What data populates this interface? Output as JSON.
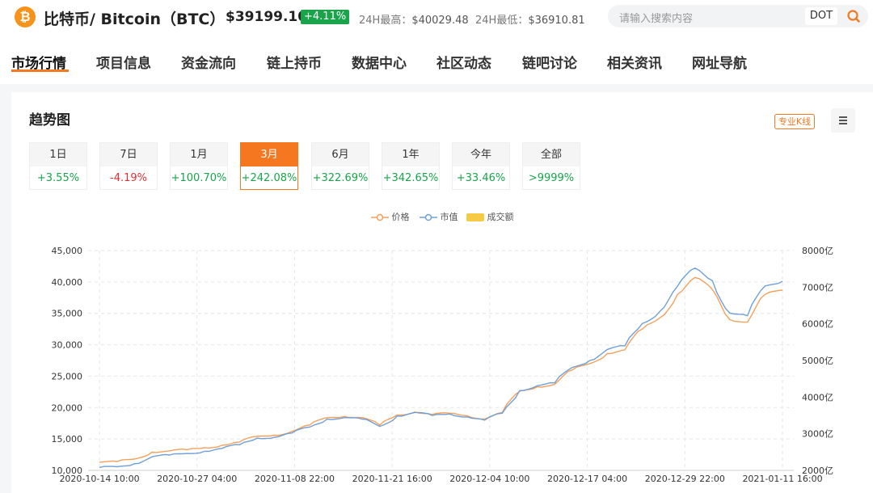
{
  "header": {
    "coin_logo_glyph": "₿",
    "coin_name": "比特币/ Bitcoin（BTC）",
    "price": "$39199.10",
    "change": "+4.11%",
    "high_label": "24H最高：",
    "high_value": "$40029.48",
    "low_label": "24H最低：",
    "low_value": "$36910.81",
    "search_placeholder": "请输入搜索内容",
    "search_tag": "DOT",
    "search_icon": "search-icon"
  },
  "nav": {
    "items": [
      {
        "label": "市场行情"
      },
      {
        "label": "项目信息"
      },
      {
        "label": "资金流向"
      },
      {
        "label": "链上持币"
      },
      {
        "label": "数据中心"
      },
      {
        "label": "社区动态"
      },
      {
        "label": "链吧讨论"
      },
      {
        "label": "相关资讯"
      },
      {
        "label": "网址导航"
      }
    ]
  },
  "trend": {
    "title": "趋势图",
    "pro_kline": "专业K线",
    "menu_icon": "menu-icon",
    "periods": [
      {
        "label": "1日",
        "change": "+3.55%",
        "dir": "up"
      },
      {
        "label": "7日",
        "change": "-4.19%",
        "dir": "down"
      },
      {
        "label": "1月",
        "change": "+100.70%",
        "dir": "up"
      },
      {
        "label": "3月",
        "change": "+242.08%",
        "dir": "up"
      },
      {
        "label": "6月",
        "change": "+322.69%",
        "dir": "up"
      },
      {
        "label": "1年",
        "change": "+342.65%",
        "dir": "up"
      },
      {
        "label": "今年",
        "change": "+33.46%",
        "dir": "up"
      },
      {
        "label": "全部",
        "change": ">9999%",
        "dir": "up"
      }
    ],
    "active_period": "3月"
  },
  "colors": {
    "accent": "#f57820",
    "up": "#19a44a",
    "down": "#e03030",
    "price_line": "#f5a05a",
    "cap_line": "#6f9fd8",
    "volume": "#f7ca45"
  },
  "chart_data": {
    "type": "line",
    "legend": [
      "价格",
      "市值",
      "成交额"
    ],
    "x_ticks": [
      "2020-10-14 10:00",
      "2020-10-27 04:00",
      "2020-11-08 22:00",
      "2020-11-21 16:00",
      "2020-12-04 10:00",
      "2020-12-17 04:00",
      "2020-12-29 22:00",
      "2021-01-11 16:00"
    ],
    "y_left_ticks": [
      "10,000",
      "15,000",
      "20,000",
      "25,000",
      "30,000",
      "35,000",
      "40,000",
      "45,000"
    ],
    "y_right_ticks": [
      "2000亿",
      "3000亿",
      "4000亿",
      "5000亿",
      "6000亿",
      "7000亿",
      "8000亿"
    ],
    "y_left_range": [
      10000,
      45000
    ],
    "y_right_range": [
      2000,
      8000
    ],
    "grid": true,
    "legend_position": "top-center",
    "x": [
      "10-14",
      "10-17",
      "10-20",
      "10-23",
      "10-26",
      "10-29",
      "11-01",
      "11-04",
      "11-06",
      "11-08",
      "11-11",
      "11-14",
      "11-17",
      "11-20",
      "11-22",
      "11-24",
      "11-26",
      "11-28",
      "12-01",
      "12-04",
      "12-07",
      "12-10",
      "12-12",
      "12-15",
      "12-17",
      "12-20",
      "12-23",
      "12-26",
      "12-28",
      "12-30",
      "01-01",
      "01-03",
      "01-05",
      "01-07",
      "01-08",
      "01-10",
      "01-12",
      "01-13",
      "01-14",
      "01-15"
    ],
    "series": [
      {
        "name": "价格",
        "values": [
          11300,
          11400,
          11800,
          12900,
          13100,
          13300,
          13600,
          14000,
          14500,
          15400,
          15600,
          16200,
          17200,
          18400,
          18600,
          18400,
          17200,
          18800,
          19300,
          18900,
          19100,
          18700,
          18200,
          19200,
          22600,
          23300,
          23700,
          26000,
          27000,
          28600,
          29200,
          32500,
          34300,
          38000,
          40700,
          38800,
          34000,
          33600,
          38000,
          38700
        ]
      },
      {
        "name": "市值",
        "values": [
          2080,
          2100,
          2180,
          2370,
          2420,
          2460,
          2520,
          2600,
          2700,
          2880,
          2900,
          3020,
          3180,
          3400,
          3440,
          3400,
          3200,
          3480,
          3580,
          3500,
          3540,
          3460,
          3370,
          3560,
          4180,
          4310,
          4390,
          4810,
          5000,
          5300,
          5400,
          6010,
          6340,
          7020,
          7520,
          7180,
          6290,
          6220,
          7030,
          7160
        ]
      }
    ]
  }
}
